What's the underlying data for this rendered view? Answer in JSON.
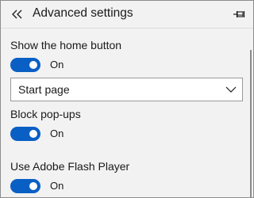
{
  "header": {
    "title": "Advanced settings",
    "back_icon": "double-chevron-left-icon",
    "pin_icon": "pin-icon"
  },
  "settings": {
    "home_button": {
      "label": "Show the home button",
      "state_label": "On",
      "enabled": true
    },
    "home_page_select": {
      "value": "Start page"
    },
    "block_popups": {
      "label": "Block pop-ups",
      "state_label": "On",
      "enabled": true
    },
    "flash_player": {
      "label": "Use Adobe Flash Player",
      "state_label": "On",
      "enabled": true
    }
  },
  "colors": {
    "accent": "#0a5fc4",
    "panel_background": "#f2f2f2"
  }
}
